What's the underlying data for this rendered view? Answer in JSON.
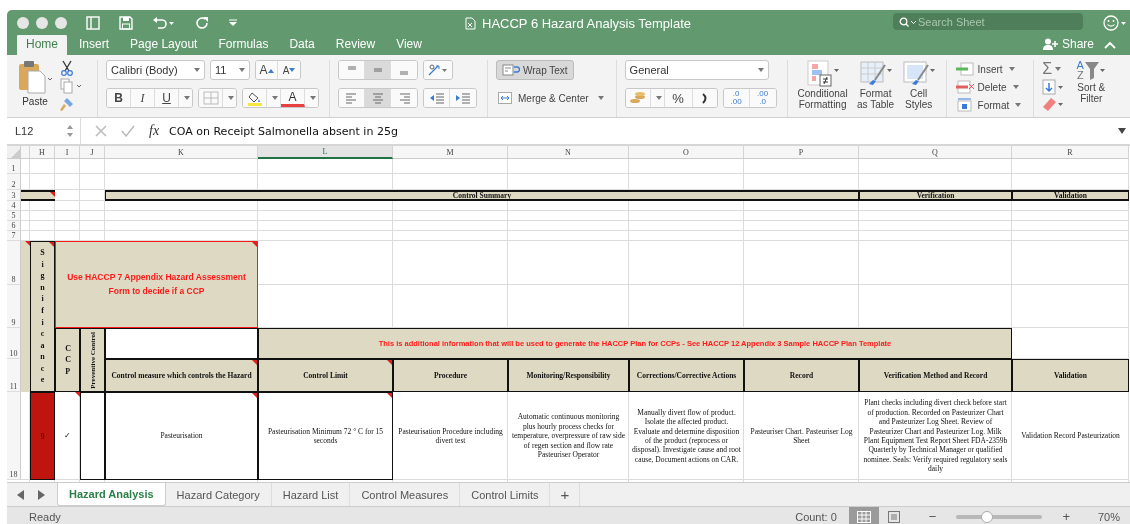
{
  "window": {
    "title": "HACCP 6 Hazard Analysis Template"
  },
  "search": {
    "placeholder": "Search Sheet"
  },
  "share": {
    "label": "Share"
  },
  "ribbon_tabs": [
    {
      "label": "Home",
      "selected": true
    },
    {
      "label": "Insert",
      "selected": false
    },
    {
      "label": "Page Layout",
      "selected": false
    },
    {
      "label": "Formulas",
      "selected": false
    },
    {
      "label": "Data",
      "selected": false
    },
    {
      "label": "Review",
      "selected": false
    },
    {
      "label": "View",
      "selected": false
    }
  ],
  "ribbon": {
    "paste": "Paste",
    "font_name": "Calibri (Body)",
    "font_size": "11",
    "grow_font": "A",
    "shrink_font": "A",
    "bold": "B",
    "italic": "I",
    "underline": "U",
    "font_color": "A",
    "vertical_align": [
      {
        "selected": false
      },
      {
        "selected": true
      },
      {
        "selected": false
      }
    ],
    "horizontal_align": [
      {
        "selected": false
      },
      {
        "selected": true
      },
      {
        "selected": false
      }
    ],
    "wrap_text": {
      "label": "Wrap Text",
      "on": true
    },
    "merge_center": "Merge & Center",
    "number_format": "General",
    "percent": "%",
    "increase_decimal": [
      ".0",
      ".00"
    ],
    "decrease_decimal": [
      ".00",
      ".0"
    ],
    "conditional_formatting": "Conditional Formatting",
    "format_as_table": "Format as Table",
    "cell_styles": "Cell Styles",
    "insert": "Insert",
    "delete": "Delete",
    "format": "Format",
    "autosum": "Σ",
    "sort_letters": [
      "A",
      "Z"
    ],
    "sort_filter": "Sort & Filter"
  },
  "formula_bar": {
    "name_box": "L12",
    "fx": "fx",
    "value": "COA on Receipt Salmonella absent in 25g"
  },
  "columns": [
    {
      "label": "H",
      "selected": false
    },
    {
      "label": "I",
      "selected": false
    },
    {
      "label": "J",
      "selected": false
    },
    {
      "label": "K",
      "selected": false
    },
    {
      "label": "L",
      "selected": true
    },
    {
      "label": "M",
      "selected": false
    },
    {
      "label": "N",
      "selected": false
    },
    {
      "label": "O",
      "selected": false
    },
    {
      "label": "P",
      "selected": false
    },
    {
      "label": "Q",
      "selected": false
    },
    {
      "label": "R",
      "selected": false
    }
  ],
  "rows": [
    "1",
    "2",
    "3",
    "4",
    "5",
    "6",
    "7",
    "8",
    "9",
    "10",
    "11",
    "18"
  ],
  "sheet": {
    "control_summary": "Control Summary",
    "verification": "Verification",
    "validation": "Validation",
    "significance": "Significance",
    "ccp": "CCP",
    "preventive_control": "Preventive Control",
    "note": "Use HACCP 7 Appendix Hazard Assessment Form to decide if a CCP",
    "banner": "This is additional information that will be used to generate the HACCP Plan for CCPs - See HACCP 12 Appendix 3 Sample HACCP Plan Template",
    "headings": [
      "Control measure which controls the Hazard",
      "Control Limit",
      "Procedure",
      "Monitoring/Responsibility",
      "Corrections/Corrective Actions",
      "Record",
      "Verification Method and Record",
      "Validation"
    ],
    "hazard_row": {
      "significance": "9",
      "ccp": "✓",
      "cells": [
        "Pasteurisation",
        "Pasteurisation Minimum 72 ° C for 15 seconds",
        "Pasteurisation Procedure including divert test",
        "Automatic continuous monitoring plus hourly process checks for temperature, overpressure of raw side of regen section and flow rate Pasteuriser Operator",
        "Manually divert flow of product. Isolate the affected product. Evaluate and determine disposition of the product (reprocess or disposal). Investigate cause and root cause, Document actions on CAR.",
        "Pasteuriser Chart. Pasteuriser Log Sheet",
        "Plant checks including divert check before start of production. Recorded on Pasteurizer Chart and Pasteurizer Log Sheet. Review of Pasteurizer Chart and Pasteurizer Log. Milk Plant Equipment Test Report Sheet FDA-2359b Quarterly by Technical Manager or qualified nominee. Seals: Verify required regulatory seals daily",
        "Validation Record Pasteurization"
      ]
    }
  },
  "sheet_tabs": [
    {
      "label": "Hazard Analysis",
      "selected": true
    },
    {
      "label": "Hazard Category",
      "selected": false
    },
    {
      "label": "Hazard List",
      "selected": false
    },
    {
      "label": "Control Measures",
      "selected": false
    },
    {
      "label": "Control Limits",
      "selected": false
    }
  ],
  "add_sheet": "+",
  "status_bar": {
    "mode": "Ready",
    "count": "Count: 0",
    "views": [
      {
        "kind": "normal",
        "selected": true
      },
      {
        "kind": "page",
        "selected": false
      }
    ],
    "zoom_out": "−",
    "zoom_in": "+",
    "zoom": {
      "level": 0.36
    },
    "zoom_label": "70%"
  }
}
